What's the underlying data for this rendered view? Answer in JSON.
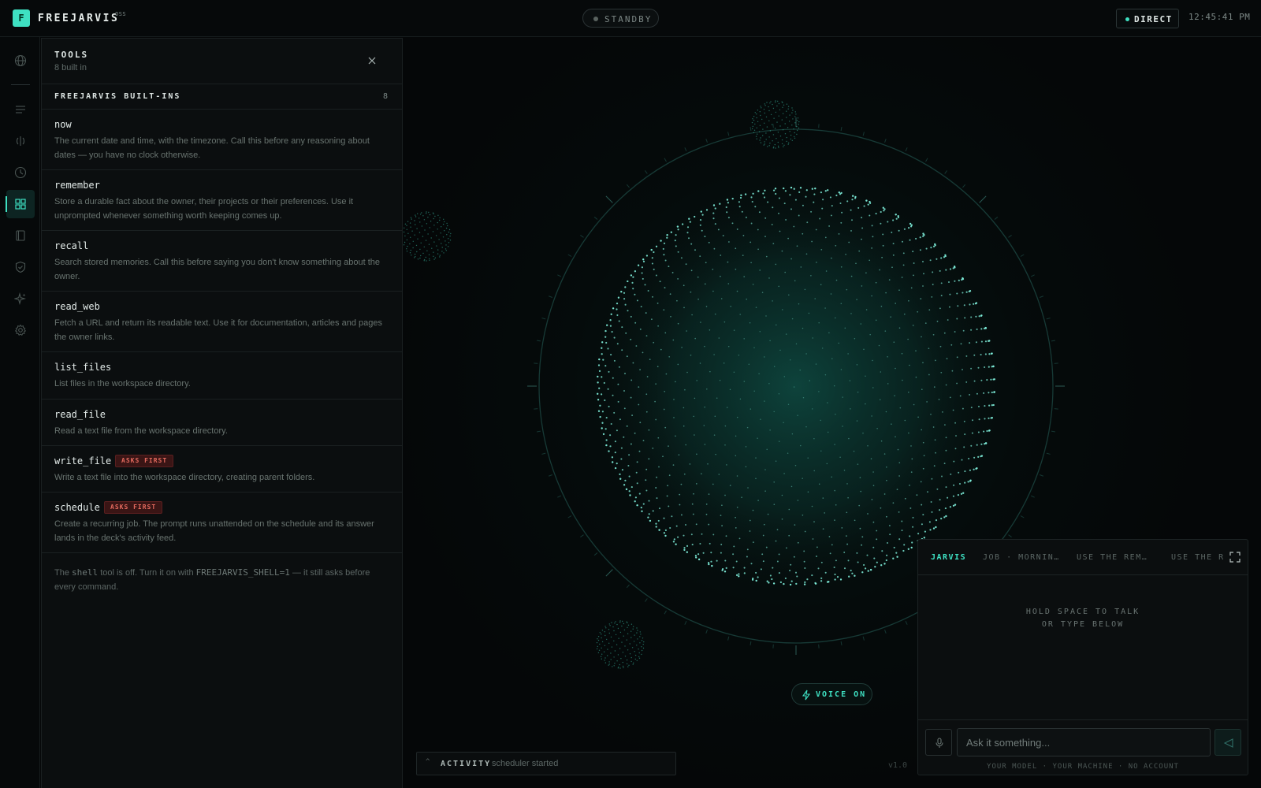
{
  "app": {
    "logo_letter": "F",
    "title": "FREEJARVIS",
    "superscript": "OSS"
  },
  "status": {
    "label": "STANDBY"
  },
  "mode": {
    "label": "DIRECT"
  },
  "clock": "12:45:41 PM",
  "rail": {
    "items": [
      {
        "name": "globe-icon"
      },
      {
        "name": "list-icon"
      },
      {
        "name": "skills-icon"
      },
      {
        "name": "clock-icon"
      },
      {
        "name": "grid-icon",
        "active": true
      },
      {
        "name": "book-icon"
      },
      {
        "name": "shield-icon"
      },
      {
        "name": "sparkle-icon"
      },
      {
        "name": "gear-icon"
      }
    ]
  },
  "tools_panel": {
    "title": "TOOLS",
    "subtitle": "8 built in",
    "group": {
      "title": "FREEJARVIS BUILT-INS",
      "count": "8"
    },
    "tools": [
      {
        "name": "now",
        "badge": "",
        "desc": "The current date and time, with the timezone. Call this before any reasoning about dates — you have no clock otherwise."
      },
      {
        "name": "remember",
        "badge": "",
        "desc": "Store a durable fact about the owner, their projects or their preferences. Use it unprompted whenever something worth keeping comes up."
      },
      {
        "name": "recall",
        "badge": "",
        "desc": "Search stored memories. Call this before saying you don't know something about the owner."
      },
      {
        "name": "read_web",
        "badge": "",
        "desc": "Fetch a URL and return its readable text. Use it for documentation, articles and pages the owner links."
      },
      {
        "name": "list_files",
        "badge": "",
        "desc": "List files in the workspace directory."
      },
      {
        "name": "read_file",
        "badge": "",
        "desc": "Read a text file from the workspace directory."
      },
      {
        "name": "write_file",
        "badge": "ASKS FIRST",
        "desc": "Write a text file into the workspace directory, creating parent folders."
      },
      {
        "name": "schedule",
        "badge": "ASKS FIRST",
        "desc": "Create a recurring job. The prompt runs unattended on the schedule and its answer lands in the deck's activity feed."
      }
    ],
    "shell_note": {
      "prefix": "The ",
      "code": "shell",
      "middle": " tool is off. Turn it on with ",
      "env": "FREEJARVIS_SHELL=1",
      "suffix": " — it still asks before every command."
    }
  },
  "voice": {
    "label": "VOICE ON"
  },
  "activity": {
    "label": "ACTIVITY",
    "message": "scheduler started"
  },
  "version": "v1.0",
  "chat": {
    "tabs": [
      "JARVIS",
      "JOB · MORNIN…",
      "USE THE REM…",
      "USE THE R"
    ],
    "hint_line1": "HOLD SPACE TO TALK",
    "hint_line2": "OR TYPE BELOW",
    "input_placeholder": "Ask it something...",
    "footer": "YOUR MODEL · YOUR MACHINE · NO ACCOUNT"
  },
  "colors": {
    "accent": "#3ee0c2",
    "background": "#050708",
    "panel": "#0b0e0f",
    "danger": "#e46a5e"
  }
}
